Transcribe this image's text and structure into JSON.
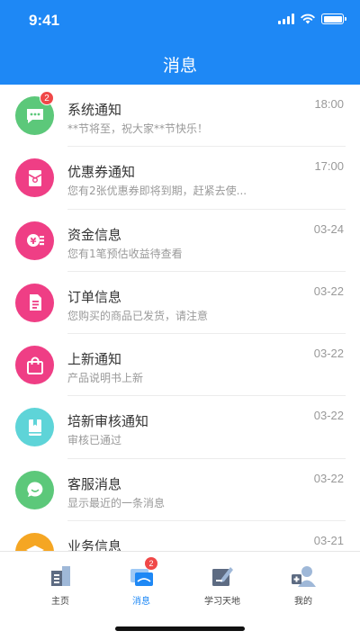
{
  "status": {
    "time": "9:41"
  },
  "header": {
    "title": "消息"
  },
  "messages": [
    {
      "title": "系统通知",
      "subtitle": "**节将至，祝大家**节快乐！",
      "time": "18:00",
      "badge": "2",
      "icon": "chat-bubble-icon",
      "color": "#5cc87a"
    },
    {
      "title": "优惠券通知",
      "subtitle": "您有2张优惠券即将到期，赶紧去使...",
      "time": "17:00",
      "badge": "",
      "icon": "coupon-icon",
      "color": "#ef3e85"
    },
    {
      "title": "资金信息",
      "subtitle": "您有1笔预估收益待查看",
      "time": "03-24",
      "badge": "",
      "icon": "money-icon",
      "color": "#ef3e85"
    },
    {
      "title": "订单信息",
      "subtitle": "您购买的商品已发货，请注意",
      "time": "03-22",
      "badge": "",
      "icon": "document-icon",
      "color": "#ef3e85"
    },
    {
      "title": "上新通知",
      "subtitle": "产品说明书上新",
      "time": "03-22",
      "badge": "",
      "icon": "shopping-bag-icon",
      "color": "#ef3e85"
    },
    {
      "title": "培新审核通知",
      "subtitle": "审核已通过",
      "time": "03-22",
      "badge": "",
      "icon": "book-icon",
      "color": "#5ed4d8"
    },
    {
      "title": "客服消息",
      "subtitle": "显示最近的一条消息",
      "time": "03-22",
      "badge": "",
      "icon": "chat-icon",
      "color": "#5cc87a"
    },
    {
      "title": "业务信息",
      "subtitle": "",
      "time": "03-21",
      "badge": "",
      "icon": "graduation-cap-icon",
      "color": "#f5a623"
    }
  ],
  "tabbar": [
    {
      "label": "主页",
      "icon": "home-building-icon",
      "active": false,
      "badge": ""
    },
    {
      "label": "消息",
      "icon": "message-icon",
      "active": true,
      "badge": "2"
    },
    {
      "label": "学习天地",
      "icon": "study-edit-icon",
      "active": false,
      "badge": ""
    },
    {
      "label": "我的",
      "icon": "profile-icon",
      "active": false,
      "badge": ""
    }
  ],
  "colors": {
    "primary": "#1e88f5",
    "badge": "#f04848"
  }
}
